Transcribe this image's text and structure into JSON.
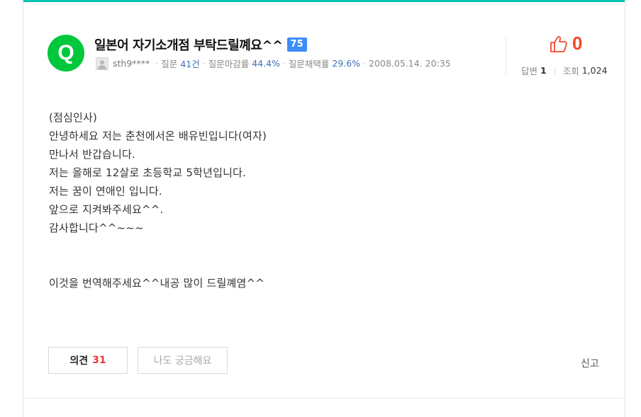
{
  "question": {
    "title": "일본어 자기소개점 부탁드릴꼐요^^",
    "points": "75",
    "author": {
      "name": "sth9****",
      "question_label": "질문",
      "question_count": "41건",
      "close_rate_label": "질문마감률",
      "close_rate": "44.4%",
      "adopt_rate_label": "질문채택률",
      "adopt_rate": "29.6%"
    },
    "date": "2008.05.14. 20:35",
    "likes": "0",
    "answers_label": "답변",
    "answers": "1",
    "views_label": "조회",
    "views": "1,024",
    "body": {
      "lines": [
        "(점심인사)",
        "안녕하세요 저는 춘천에서온 배유빈입니다(여자)",
        "만나서 반갑습니다.",
        "저는 올해로 12살로 초등학교 5학년입니다.",
        "저는 꿈이 연애인 입니다.",
        "앞으로 지켜봐주세요^^.",
        "감사합니다^^~~~"
      ],
      "request": "이것을 번역해주세요^^내공 많이 드릴꼐염^^"
    }
  },
  "actions": {
    "opinion_label": "의견",
    "opinion_count": "31",
    "curious_label": "나도 궁금해요",
    "report_label": "신고"
  },
  "icons": {
    "question_icon_letter": "Q",
    "question_icon": "q-circle-icon",
    "like_icon": "thumbs-up-icon",
    "avatar": "default-avatar-icon"
  },
  "colors": {
    "accent_top": "#00c4b0",
    "question_icon_bg": "#00c73c",
    "points_badge": "#3d8ef7",
    "like": "#f2492b",
    "opinion_count": "#e23b3b",
    "meta_numbers": "#3a6fb5"
  }
}
